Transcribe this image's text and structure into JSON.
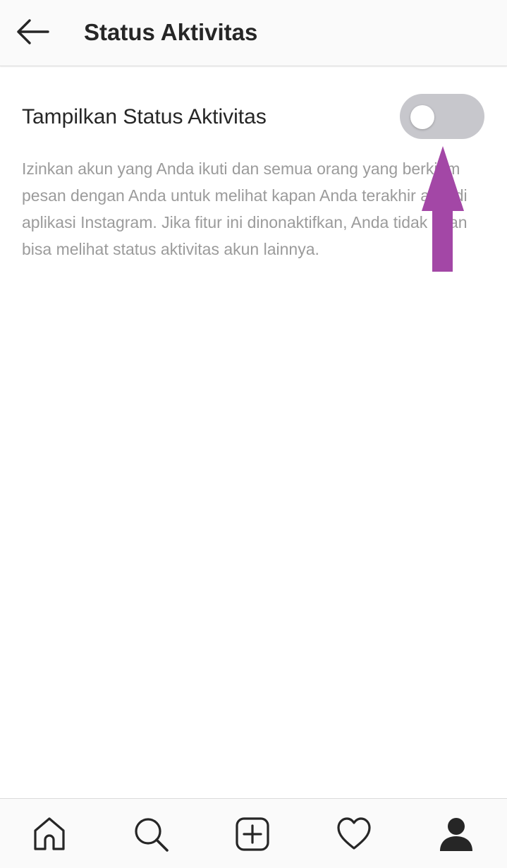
{
  "header": {
    "title": "Status Aktivitas",
    "back_icon": "arrow-left-icon"
  },
  "setting": {
    "label": "Tampilkan Status Aktivitas",
    "toggle_state": "off",
    "description": "Izinkan akun yang Anda ikuti dan semua orang yang berkirim pesan dengan Anda untuk melihat kapan Anda terakhir aktif di aplikasi Instagram. Jika fitur ini dinonaktifkan, Anda tidak akan bisa melihat status aktivitas akun lainnya."
  },
  "annotation": {
    "arrow_color": "#a347a6"
  },
  "bottom_nav": {
    "items": [
      {
        "icon": "home-icon"
      },
      {
        "icon": "search-icon"
      },
      {
        "icon": "add-post-icon"
      },
      {
        "icon": "heart-icon"
      },
      {
        "icon": "profile-icon"
      }
    ]
  },
  "colors": {
    "toggle_track": "#c7c7cc",
    "description_text": "#9b9b9b",
    "primary_text": "#262626"
  }
}
